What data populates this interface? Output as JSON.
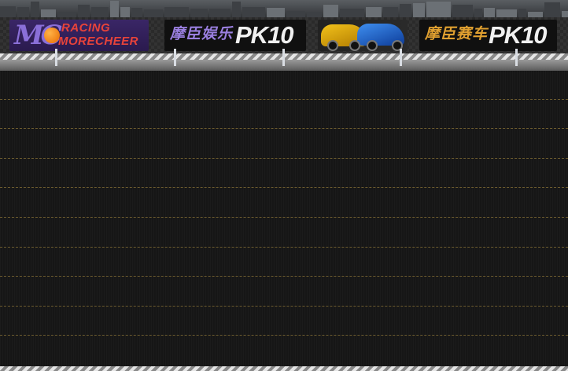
{
  "banners": {
    "banner1": {
      "logo_text": "MC",
      "line1": "RACING",
      "line2": "MORECHEER"
    },
    "banner2": {
      "chinese": "摩臣娱乐",
      "pk": "PK10"
    },
    "banner3": {
      "image": "race-cars"
    },
    "banner4": {
      "chinese": "摩臣赛车",
      "pk": "PK10"
    }
  },
  "track": {
    "lane_count": 10
  },
  "colors": {
    "background": "#151515",
    "lane_line": "#6b5a2e",
    "banner1_bg": "#3a2666",
    "banner2_text": "#9a7fe0",
    "banner4_text": "#e0a030",
    "pk_text": "#f0f0f0"
  }
}
